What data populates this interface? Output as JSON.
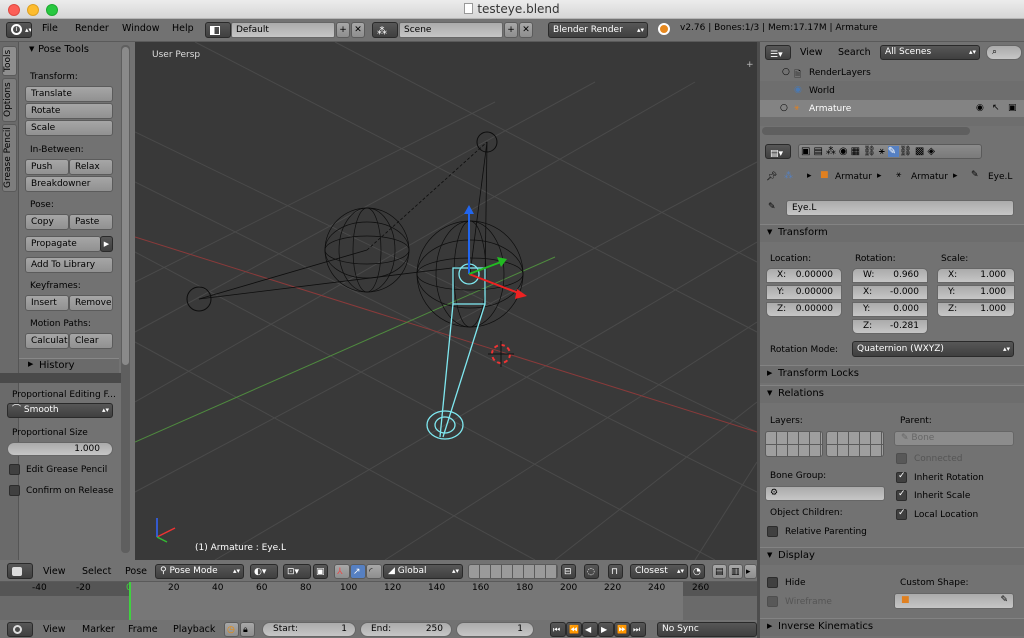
{
  "window": {
    "title": "testeye.blend"
  },
  "topbar": {
    "menus": [
      "File",
      "Render",
      "Window",
      "Help"
    ],
    "layout": "Default",
    "scene": "Scene",
    "engine": "Blender Render",
    "stats": "v2.76 | Bones:1/3 | Mem:17.17M | Armature"
  },
  "toolshelf": {
    "tabs": [
      "Tools",
      "Options",
      "Grease Pencil"
    ],
    "title": "Pose Tools",
    "transform_label": "Transform:",
    "translate": "Translate",
    "rotate": "Rotate",
    "scale": "Scale",
    "inbetween_label": "In-Between:",
    "push": "Push",
    "relax": "Relax",
    "breakdowner": "Breakdowner",
    "pose_label": "Pose:",
    "copy": "Copy",
    "paste": "Paste",
    "propagate": "Propagate",
    "add_library": "Add To Library",
    "keyframes_label": "Keyframes:",
    "insert": "Insert",
    "remove": "Remove",
    "motion_label": "Motion Paths:",
    "calculate": "Calculat",
    "clear": "Clear",
    "history": "History",
    "prop_edit_label": "Proportional Editing F...",
    "prop_edit_value": "Smooth",
    "prop_size_label": "Proportional Size",
    "prop_size_value": "1.000",
    "edit_grease": "Edit Grease Pencil",
    "confirm_release": "Confirm on Release"
  },
  "viewport": {
    "view_label": "User Persp",
    "status": "(1) Armature : Eye.L"
  },
  "viewport_header": {
    "view": "View",
    "select": "Select",
    "pose": "Pose",
    "mode": "Pose Mode",
    "orientation": "Global",
    "snap": "Closest"
  },
  "timeline": {
    "ticks": [
      "-40",
      "-20",
      "0",
      "20",
      "40",
      "60",
      "80",
      "100",
      "120",
      "140",
      "160",
      "180",
      "200",
      "220",
      "240",
      "260"
    ],
    "current": "0",
    "menus": [
      "View",
      "Marker",
      "Frame",
      "Playback"
    ],
    "start_label": "Start:",
    "start": "1",
    "end_label": "End:",
    "end": "250",
    "frame": "1",
    "sync": "No Sync"
  },
  "outliner": {
    "view": "View",
    "search": "Search",
    "filter": "All Scenes",
    "items": [
      "RenderLayers",
      "World",
      "Armature"
    ]
  },
  "properties": {
    "breadcrumb": [
      "Armatur",
      "Armatur",
      "Eye.L"
    ],
    "bone_name": "Eye.L",
    "transform": {
      "title": "Transform",
      "location_label": "Location:",
      "rotation_label": "Rotation:",
      "scale_label": "Scale:",
      "location": [
        {
          "axis": "X:",
          "value": "0.00000"
        },
        {
          "axis": "Y:",
          "value": "0.00000"
        },
        {
          "axis": "Z:",
          "value": "0.00000"
        }
      ],
      "rotation": [
        {
          "axis": "W:",
          "value": "0.960"
        },
        {
          "axis": "X:",
          "value": "-0.000"
        },
        {
          "axis": "Y:",
          "value": "0.000"
        },
        {
          "axis": "Z:",
          "value": "-0.281"
        }
      ],
      "scale": [
        {
          "axis": "X:",
          "value": "1.000"
        },
        {
          "axis": "Y:",
          "value": "1.000"
        },
        {
          "axis": "Z:",
          "value": "1.000"
        }
      ],
      "rotation_mode_label": "Rotation Mode:",
      "rotation_mode": "Quaternion (WXYZ)"
    },
    "transform_locks": "Transform Locks",
    "relations": {
      "title": "Relations",
      "layers_label": "Layers:",
      "parent_label": "Parent:",
      "parent": "Bone",
      "connected": "Connected",
      "inherit_rotation": "Inherit Rotation",
      "inherit_scale": "Inherit Scale",
      "local_location": "Local Location",
      "bone_group_label": "Bone Group:",
      "object_children_label": "Object Children:",
      "relative_parenting": "Relative Parenting"
    },
    "display": {
      "title": "Display",
      "hide": "Hide",
      "wireframe": "Wireframe",
      "custom_shape_label": "Custom Shape:"
    },
    "inverse_kinematics": "Inverse Kinematics"
  }
}
